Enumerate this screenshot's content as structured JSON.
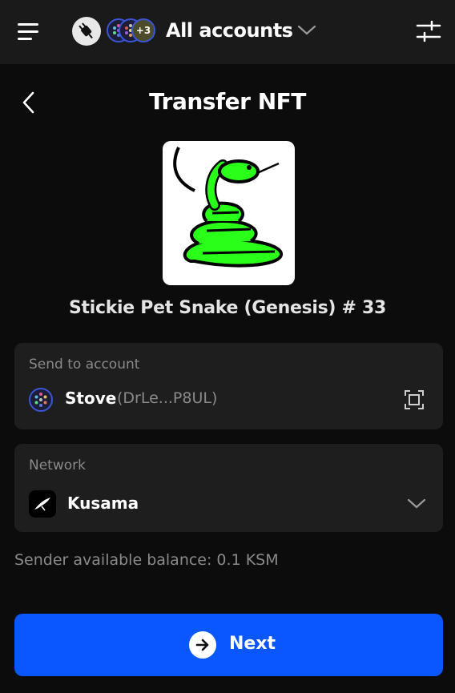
{
  "header": {
    "title": "All accounts",
    "more_accounts_badge": "+3",
    "icons": [
      "menu-icon",
      "plug-icon",
      "chevron-down-icon",
      "settings-sliders-icon"
    ]
  },
  "page": {
    "title": "Transfer NFT",
    "back_icon": "chevron-left-icon"
  },
  "nft": {
    "name": "Stickie Pet Snake (Genesis) # 33"
  },
  "send_to": {
    "label": "Send to account",
    "account_name": "Stove",
    "account_address": "(DrLe...P8UL)",
    "scan_icon": "scan-qr-icon"
  },
  "network": {
    "label": "Network",
    "selected": "Kusama",
    "icon": "kusama-logo-icon"
  },
  "balance_text": "Sender available balance: 0.1 KSM",
  "next_button": {
    "label": "Next",
    "icon": "arrow-right-circle-icon"
  },
  "colors": {
    "background": "#0c0c0c",
    "topbar": "#1a1a1a",
    "card": "#1e1e1e",
    "primary": "#0b57ff",
    "muted_text": "#8a8a8a",
    "nft_snake": "#2aff1a"
  }
}
